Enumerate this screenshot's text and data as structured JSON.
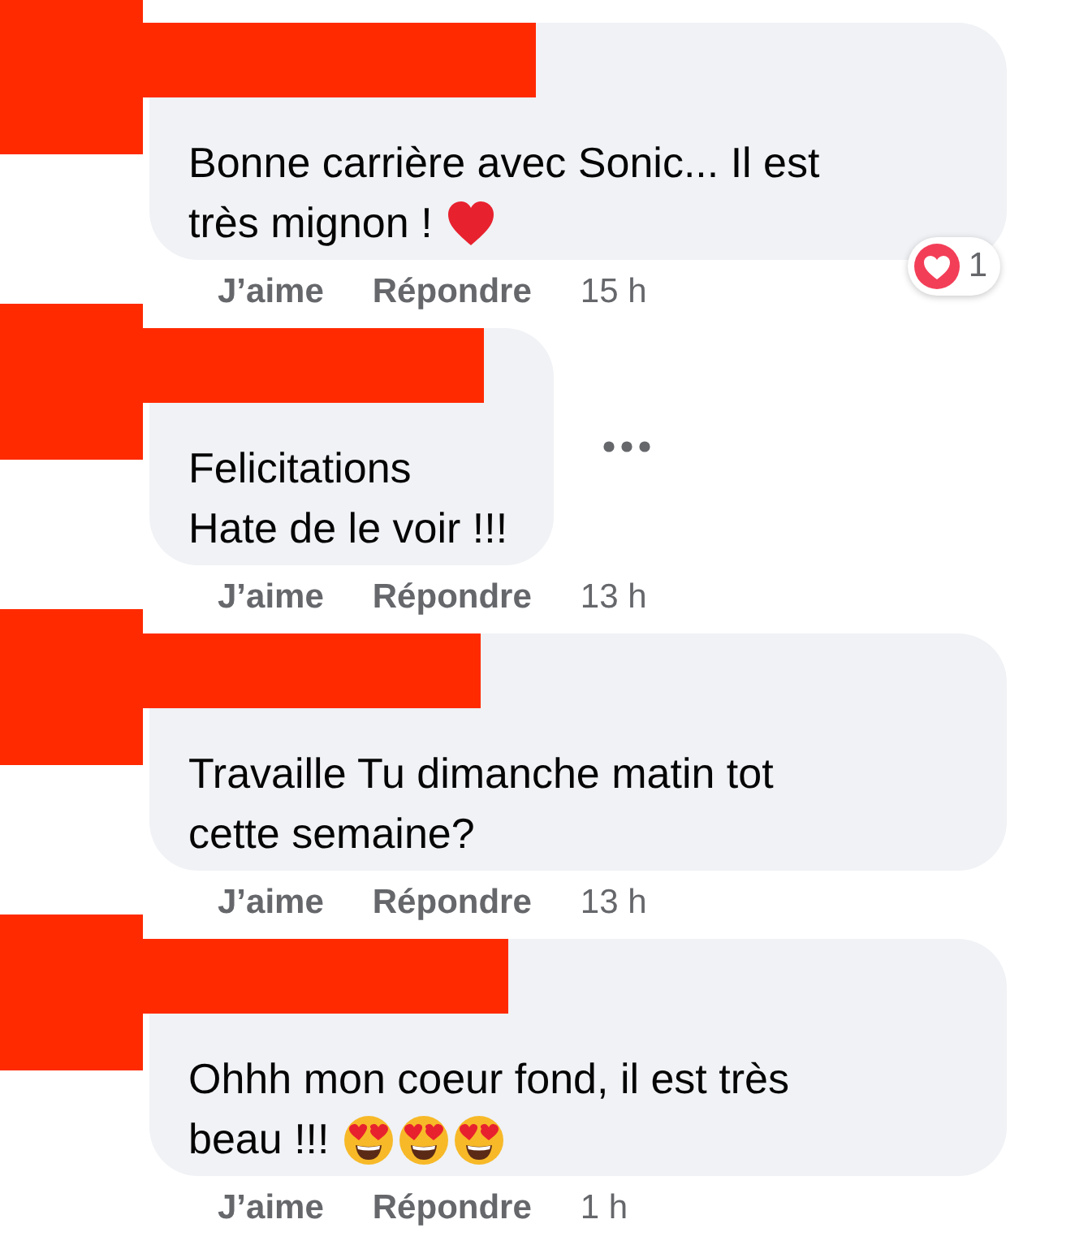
{
  "comments": [
    {
      "lines": [
        "Bonne carrière avec Sonic... Il est",
        "très mignon !"
      ],
      "emojis": [
        {
          "kind": "heart"
        }
      ],
      "actions": [
        "J’aime",
        "Répondre"
      ],
      "time": "15 h",
      "reaction": {
        "kind": "love",
        "count": "1"
      },
      "menu_visible": false
    },
    {
      "lines": [
        "Felicitations",
        "Hate de le voir !!!"
      ],
      "actions": [
        "J’aime",
        "Répondre"
      ],
      "time": "13 h",
      "menu_visible": true
    },
    {
      "lines": [
        "Travaille Tu dimanche matin tot",
        "cette semaine?"
      ],
      "actions": [
        "J’aime",
        "Répondre"
      ],
      "time": "13 h",
      "menu_visible": false
    },
    {
      "lines": [
        "Ohhh mon coeur fond, il est très",
        "beau !!!"
      ],
      "emojis": [
        {
          "kind": "heart_eyes"
        },
        {
          "kind": "heart_eyes"
        },
        {
          "kind": "heart_eyes"
        }
      ],
      "actions": [
        "J’aime",
        "Répondre"
      ],
      "time": "1 h",
      "menu_visible": false
    }
  ]
}
